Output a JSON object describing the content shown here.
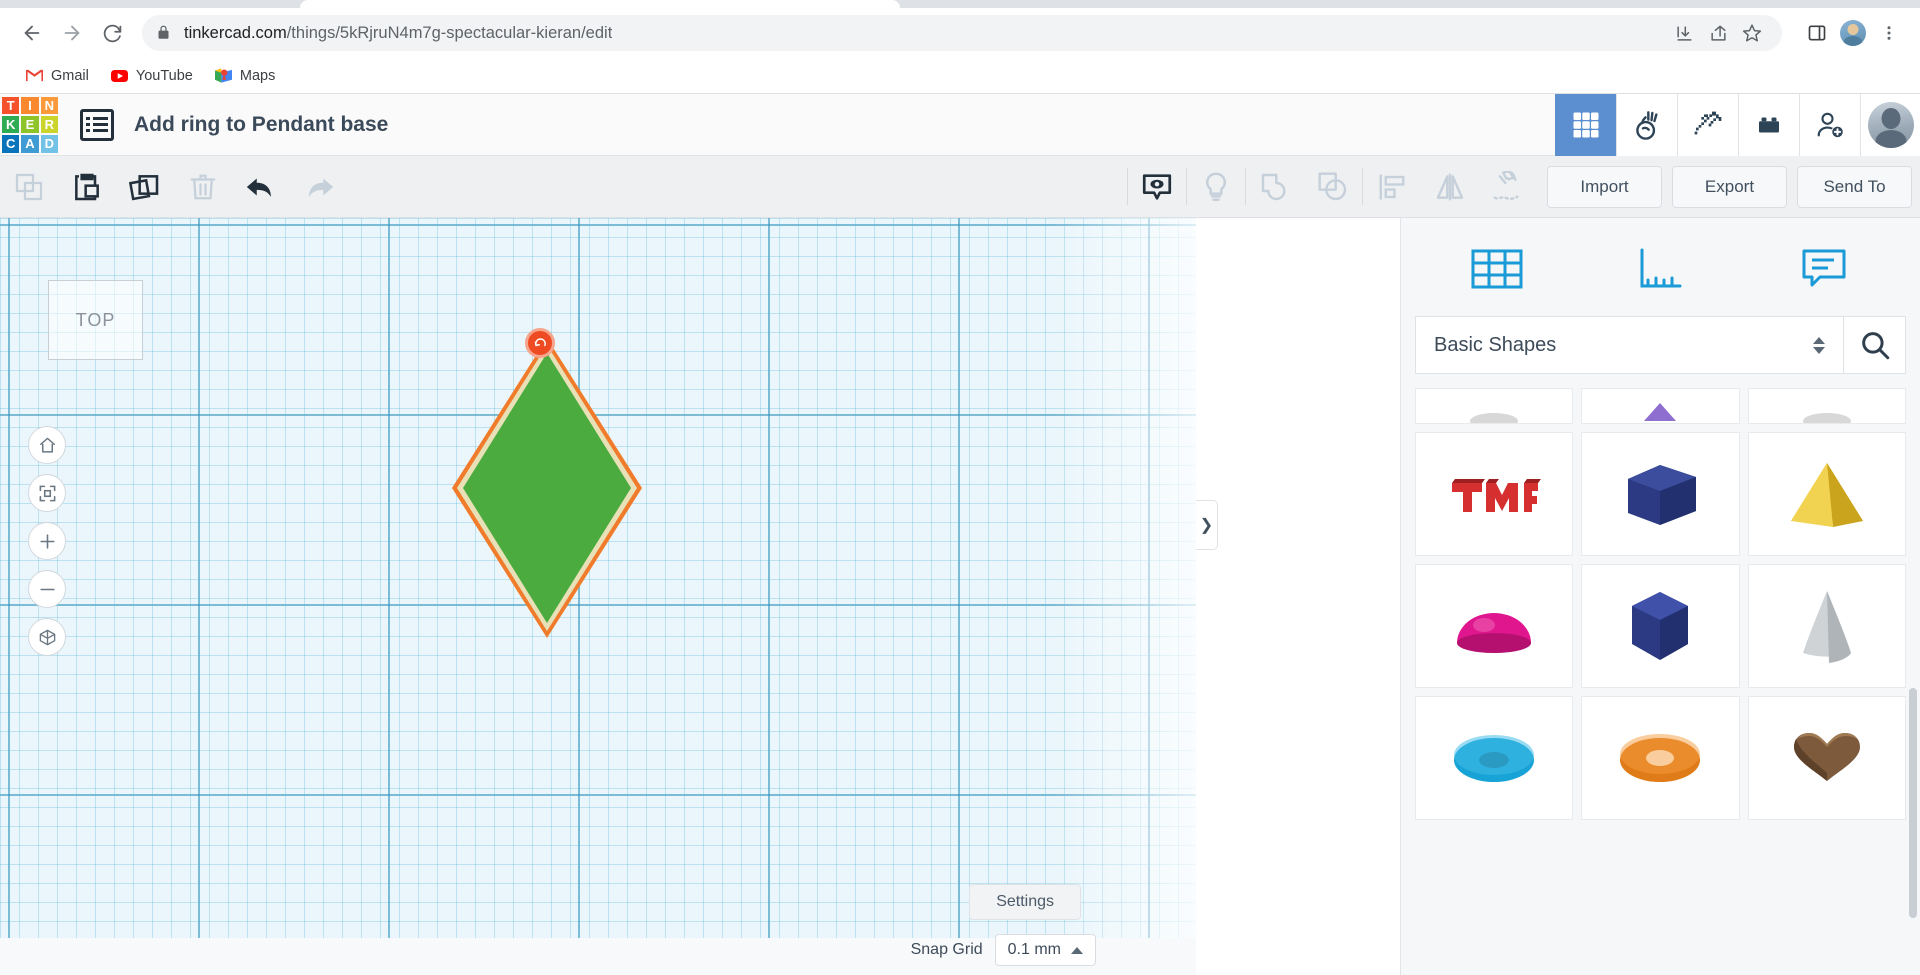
{
  "browser": {
    "url_bold": "tinkercad.com",
    "url_rest": "/things/5kRjruN4m7g-spectacular-kieran/edit",
    "nav": {
      "back": "back-arrow",
      "forward": "forward-arrow",
      "reload": "reload"
    },
    "omnibox_icons": [
      "download-icon",
      "share-icon",
      "bookmark-star-icon"
    ],
    "right_icons": [
      "side-panel-icon",
      "profile-avatar",
      "chrome-menu-icon"
    ],
    "bookmarks": [
      {
        "label": "Gmail",
        "icon": "gmail-icon"
      },
      {
        "label": "YouTube",
        "icon": "youtube-icon"
      },
      {
        "label": "Maps",
        "icon": "maps-icon"
      }
    ]
  },
  "header": {
    "logo_letters": [
      {
        "char": "T",
        "color": "#f5512a"
      },
      {
        "char": "I",
        "color": "#f9882f"
      },
      {
        "char": "N",
        "color": "#fb9a3a"
      },
      {
        "char": "K",
        "color": "#2fab53"
      },
      {
        "char": "E",
        "color": "#8fc428"
      },
      {
        "char": "R",
        "color": "#cbd42a"
      },
      {
        "char": "C",
        "color": "#0a74ba"
      },
      {
        "char": "A",
        "color": "#3e9bd4"
      },
      {
        "char": "D",
        "color": "#71c2e6"
      }
    ],
    "title": "Add ring to Pendant base",
    "tools": [
      {
        "name": "blocks-grid-icon",
        "active": true
      },
      {
        "name": "codeblocks-icon",
        "active": false
      },
      {
        "name": "minecraft-pickaxe-icon",
        "active": false
      },
      {
        "name": "lego-brick-icon",
        "active": false
      },
      {
        "name": "add-person-icon",
        "active": false
      }
    ]
  },
  "toolbar": {
    "left_tools": [
      {
        "name": "copy-icon",
        "disabled": true
      },
      {
        "name": "paste-icon",
        "disabled": false
      },
      {
        "name": "duplicate-icon",
        "disabled": false
      },
      {
        "name": "delete-trash-icon",
        "disabled": true
      },
      {
        "name": "undo-icon",
        "disabled": false
      },
      {
        "name": "redo-icon",
        "disabled": true
      }
    ],
    "center_tools": [
      {
        "name": "show-hide-eye-icon",
        "disabled": false
      },
      {
        "name": "lightbulb-icon",
        "disabled": true
      },
      {
        "name": "group-icon",
        "disabled": true
      },
      {
        "name": "ungroup-icon",
        "disabled": true
      },
      {
        "name": "align-icon",
        "disabled": true
      },
      {
        "name": "mirror-icon",
        "disabled": true
      },
      {
        "name": "workplane-magnet-icon",
        "disabled": true
      }
    ],
    "import_label": "Import",
    "export_label": "Export",
    "sendto_label": "Send To"
  },
  "canvas": {
    "view_cube_label": "TOP",
    "nav_buttons": [
      "home-view-icon",
      "fit-all-icon",
      "zoom-in-icon",
      "zoom-out-icon",
      "perspective-toggle-icon"
    ],
    "settings_label": "Settings",
    "snap_grid_label": "Snap Grid",
    "snap_grid_value": "0.1 mm",
    "selected_shape": {
      "name": "diamond-shape",
      "fill_color": "#4bab3f",
      "outline_color": "#f07b2a",
      "handle_color": "#ef4b23"
    },
    "panel_toggle_icon": "chevron-right-icon"
  },
  "shapes_panel": {
    "top_icons": [
      "shapes-grid-icon",
      "ruler-icon",
      "notes-icon"
    ],
    "category_value": "Basic Shapes",
    "search_icon": "search-icon",
    "shapes": [
      {
        "name": "partial-shape-top-left",
        "kind": "clipped",
        "color": "#d8d8d8"
      },
      {
        "name": "partial-shape-top-mid",
        "kind": "clipped-cone",
        "color": "#8e6fd0"
      },
      {
        "name": "partial-shape-top-right",
        "kind": "clipped",
        "color": "#d8d8d8"
      },
      {
        "name": "text-shape",
        "kind": "text",
        "color": "#d62f2f"
      },
      {
        "name": "box-shape",
        "kind": "box",
        "color": "#2b3a82"
      },
      {
        "name": "pyramid-shape",
        "kind": "pyramid",
        "color": "#e8c12a"
      },
      {
        "name": "half-sphere-shape",
        "kind": "dome",
        "color": "#e0168e"
      },
      {
        "name": "cylinder-shape",
        "kind": "cylinder",
        "color": "#2b3a82"
      },
      {
        "name": "cone-shape",
        "kind": "cone",
        "color": "#cfd3d6"
      },
      {
        "name": "torus-shape",
        "kind": "torus",
        "color": "#17a3d6"
      },
      {
        "name": "tube-shape",
        "kind": "tube",
        "color": "#e07b1a"
      },
      {
        "name": "heart-shape",
        "kind": "heart",
        "color": "#7d5a3c"
      }
    ]
  }
}
